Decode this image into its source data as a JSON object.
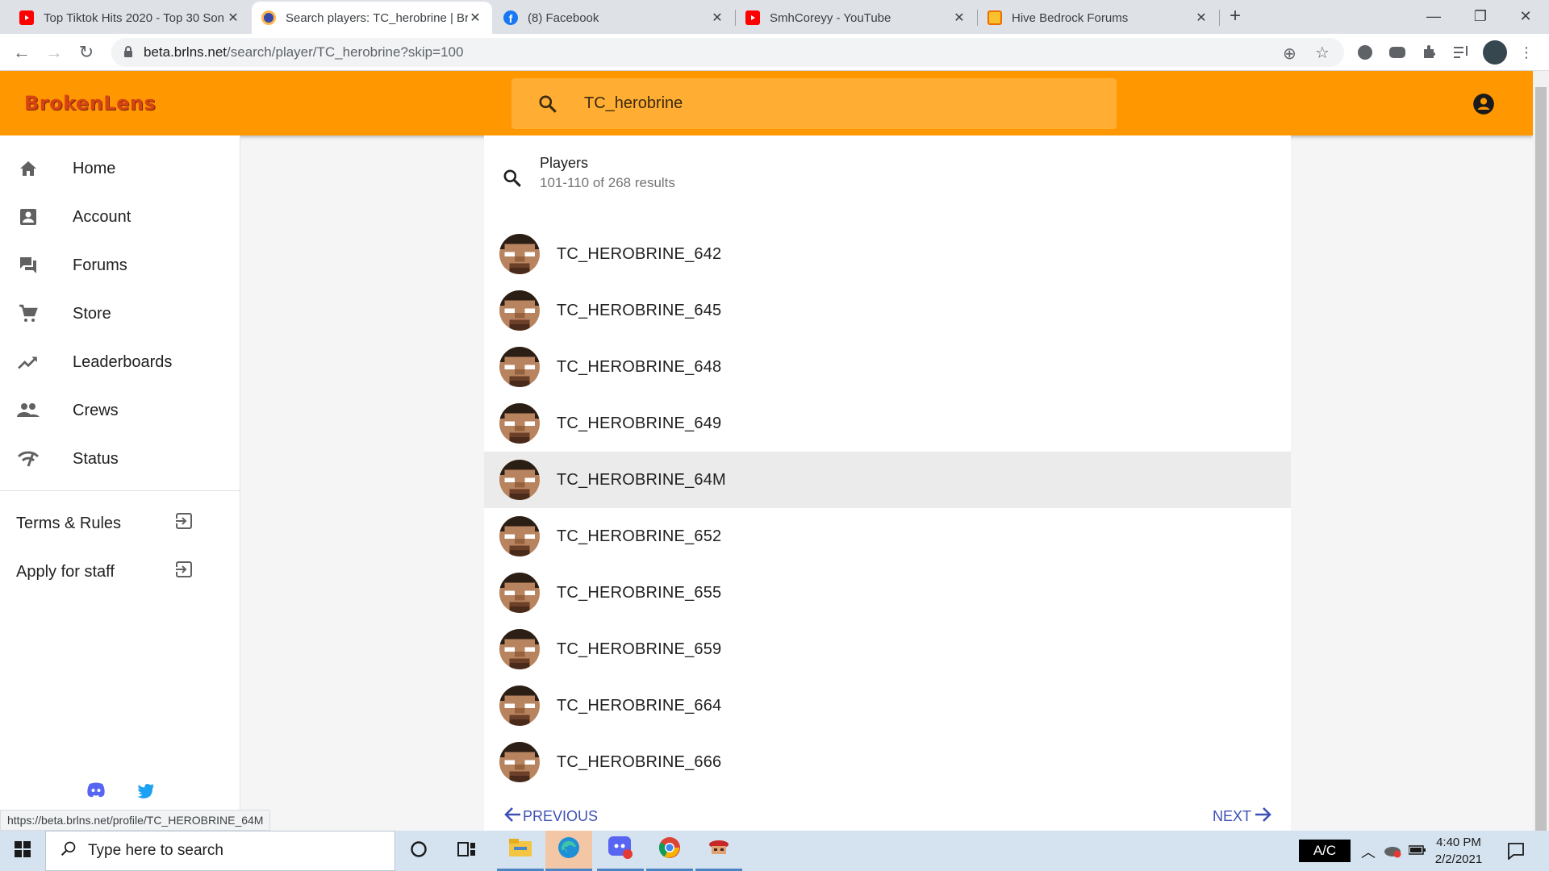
{
  "browser": {
    "tabs": [
      {
        "title": "Top Tiktok Hits 2020 - Top 30 Son",
        "favicon": "youtube-icon"
      },
      {
        "title": "Search players: TC_herobrine | Br",
        "favicon": "brokenlens-icon"
      },
      {
        "title": "(8) Facebook",
        "favicon": "facebook-icon"
      },
      {
        "title": "SmhCoreyy - YouTube",
        "favicon": "youtube-icon"
      },
      {
        "title": "Hive Bedrock Forums",
        "favicon": "hive-icon"
      }
    ],
    "url_host": "beta.brlns.net",
    "url_path": "/search/player/TC_herobrine?skip=100",
    "status_url": "https://beta.brlns.net/profile/TC_HEROBRINE_64M"
  },
  "header": {
    "logo": "BrokenLens",
    "search_query": "TC_herobrine"
  },
  "sidebar": {
    "items": [
      {
        "label": "Home",
        "icon": "home-icon"
      },
      {
        "label": "Account",
        "icon": "account-box-icon"
      },
      {
        "label": "Forums",
        "icon": "forum-icon"
      },
      {
        "label": "Store",
        "icon": "cart-icon"
      },
      {
        "label": "Leaderboards",
        "icon": "trending-up-icon"
      },
      {
        "label": "Crews",
        "icon": "group-icon"
      },
      {
        "label": "Status",
        "icon": "signal-icon"
      }
    ],
    "links": [
      {
        "label": "Terms & Rules"
      },
      {
        "label": "Apply for staff"
      }
    ]
  },
  "results": {
    "heading": "Players",
    "summary": "101-110 of 268 results",
    "players": [
      "TC_HEROBRINE_642",
      "TC_HEROBRINE_645",
      "TC_HEROBRINE_648",
      "TC_HEROBRINE_649",
      "TC_HEROBRINE_64M",
      "TC_HEROBRINE_652",
      "TC_HEROBRINE_655",
      "TC_HEROBRINE_659",
      "TC_HEROBRINE_664",
      "TC_HEROBRINE_666"
    ],
    "hovered_index": 4,
    "prev_label": "PREVIOUS",
    "next_label": "NEXT"
  },
  "taskbar": {
    "search_placeholder": "Type here to search",
    "ac_label": "A/C",
    "time": "4:40 PM",
    "date": "2/2/2021"
  },
  "colors": {
    "brand": "#ff9800",
    "search_bg": "#ffad33",
    "link": "#3f51b5"
  }
}
